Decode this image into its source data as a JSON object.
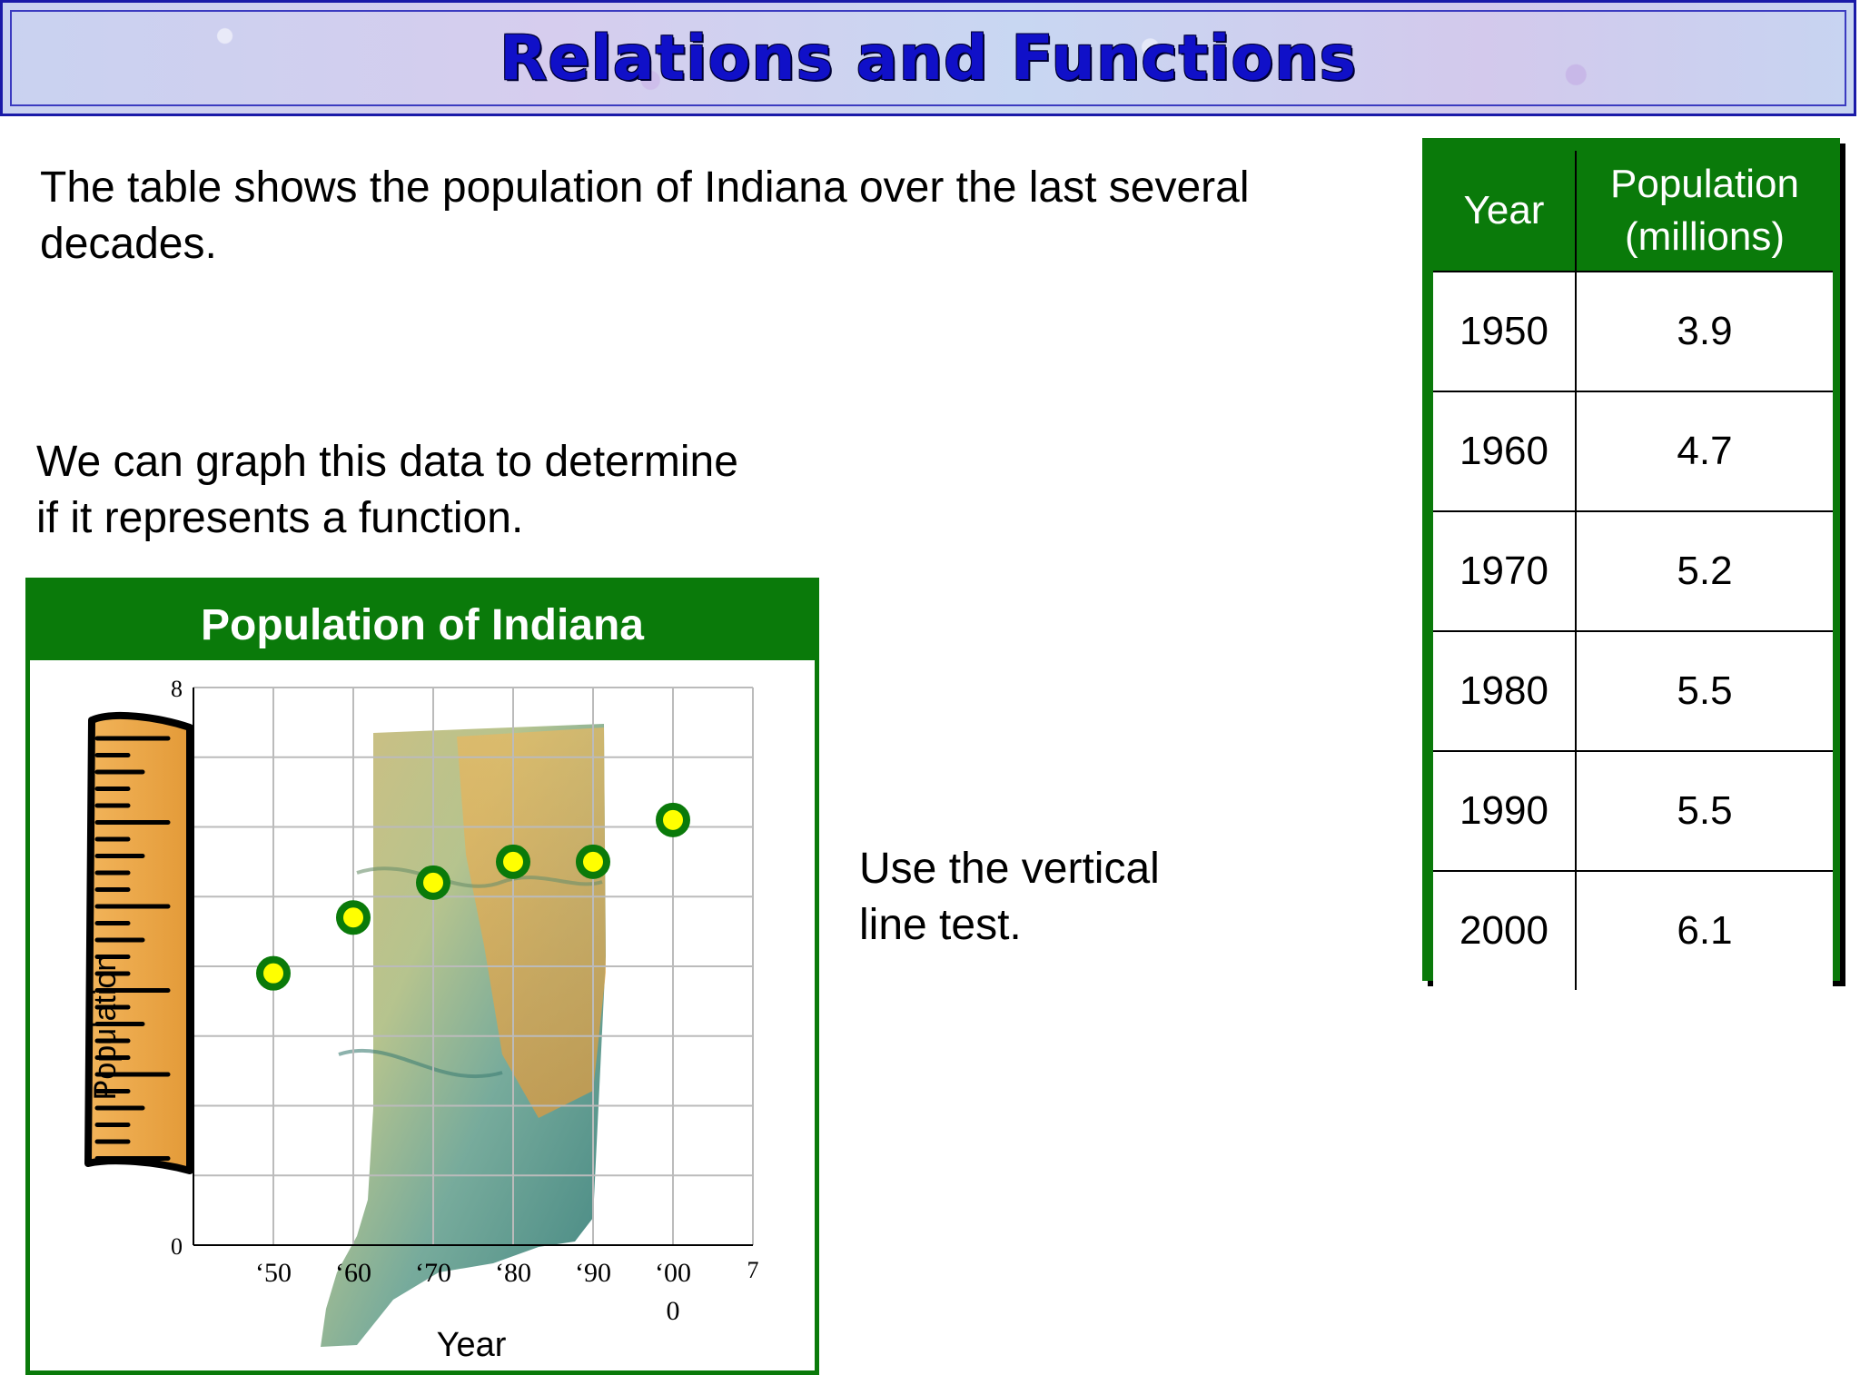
{
  "slide": {
    "title": "Relations and Functions",
    "intro": "The table shows the population of Indiana over the last several decades.",
    "graph_note_line1": "We can graph this data to determine",
    "graph_note_line2": "if it represents a function.",
    "vlt_line1": "Use the vertical",
    "vlt_line2": "line test."
  },
  "table": {
    "headers": [
      "Year",
      "Population",
      "(millions)"
    ],
    "rows": [
      {
        "year": "1950",
        "population": "3.9"
      },
      {
        "year": "1960",
        "population": "4.7"
      },
      {
        "year": "1970",
        "population": "5.2"
      },
      {
        "year": "1980",
        "population": "5.5"
      },
      {
        "year": "1990",
        "population": "5.5"
      },
      {
        "year": "2000",
        "population": "6.1"
      }
    ]
  },
  "colors": {
    "accent_green": "#0a7a0a",
    "title_blue": "#1010c8",
    "point_fill": "#ffff00",
    "point_ring": "#0a7a0a"
  },
  "chart_data": {
    "type": "scatter",
    "title": "Population of Indiana",
    "xlabel": "Year",
    "ylabel": "Population",
    "x_tick_labels": [
      "‘50",
      "‘60",
      "‘70",
      "‘80",
      "‘90",
      "‘00"
    ],
    "x_tick_extra": [
      "0",
      "7"
    ],
    "y_tick_labels": [
      "0",
      "8"
    ],
    "x": [
      "1950",
      "1960",
      "1970",
      "1980",
      "1990",
      "2000"
    ],
    "y": [
      3.9,
      4.7,
      5.2,
      5.5,
      5.5,
      6.1
    ],
    "ylim": [
      0,
      8
    ],
    "grid": true,
    "background_image": "indiana-map",
    "decoration": "ruler-icon"
  }
}
